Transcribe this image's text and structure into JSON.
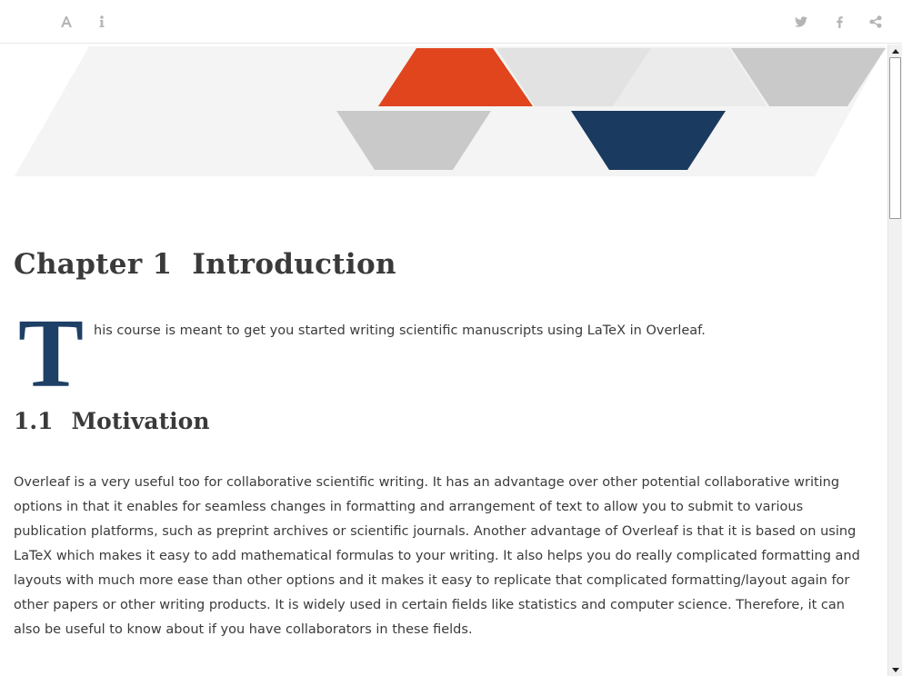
{
  "toolbar": {
    "left_icons": [
      "font-size-icon",
      "info-icon"
    ],
    "right_icons": [
      "twitter-icon",
      "facebook-icon",
      "share-icon"
    ],
    "icon_color": "#b5b5b5"
  },
  "banner": {
    "colors": {
      "orange": "#e0451d",
      "navy": "#1b3a5f",
      "gray": "#c9c9c9",
      "light": "#ebebeb",
      "background": "#f4f4f4"
    }
  },
  "chapter": {
    "label": "Chapter 1",
    "title": "Introduction"
  },
  "intro": {
    "dropcap": "T",
    "text": "his course is meant to get you started writing scientific manuscripts using LaTeX in Overleaf."
  },
  "section": {
    "number": "1.1",
    "title": "Motivation"
  },
  "paragraph": "Overleaf is a very useful too for collaborative scientific writing. It has an advantage over other potential collaborative writing options in that it enables for seamless changes in formatting and arrangement of text to allow you to submit to various publication platforms, such as preprint archives or scientific journals. Another advantage of Overleaf is that it is based on using LaTeX which makes it easy to add mathematical formulas to your writing. It also helps you do really complicated formatting and layouts with much more ease than other options and it makes it easy to replicate that complicated formatting/layout again for other papers or other writing products. It is widely used in certain fields like statistics and computer science. Therefore, it can also be useful to know about if you have collaborators in these fields.",
  "accent_color": "#1e3f66"
}
